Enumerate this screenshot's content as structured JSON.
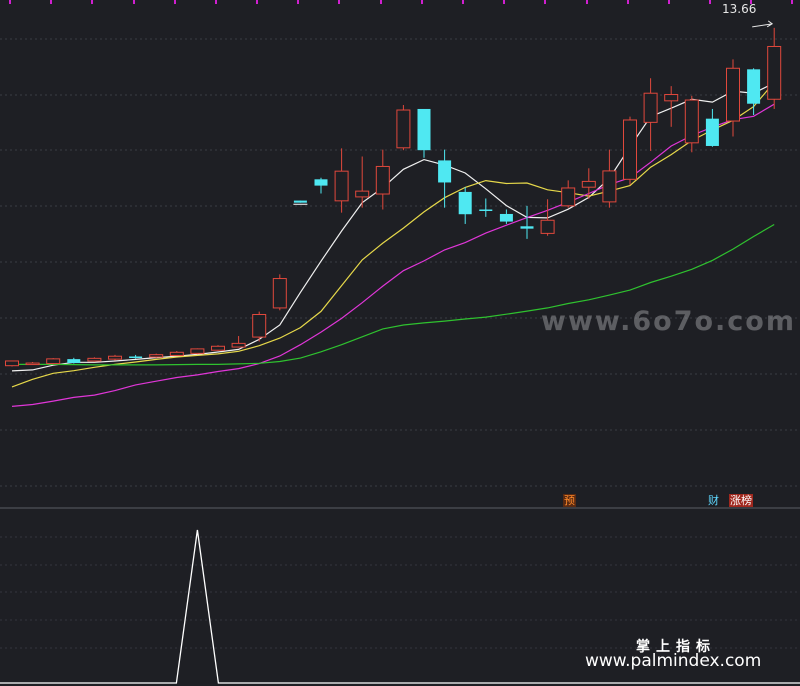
{
  "price_label": "13.66",
  "tags": {
    "yu": "预",
    "cai": "财",
    "zhang": "涨榜"
  },
  "watermark": "www.6o7o.com",
  "footer": {
    "cn": "掌上指标",
    "url": "www.palmindex.com"
  },
  "colors": {
    "background": "#1e1f24",
    "up_candle": "#e0483c",
    "down_candle": "#4fe8f2",
    "ma5": "#f0f0f0",
    "ma10": "#e6d84a",
    "ma20": "#e036d8",
    "ma60": "#2fc22f",
    "signal_line": "#ffffff",
    "top_markers": "#d020d0"
  },
  "chart_data": {
    "type": "candlestick",
    "title": "",
    "ylim": [
      0,
      100
    ],
    "candles": [
      {
        "o": 4.5,
        "c": 6.3,
        "h": 6.4,
        "l": 4.2
      },
      {
        "o": 5.3,
        "c": 5.5,
        "h": 5.9,
        "l": 5.1
      },
      {
        "o": 5.3,
        "c": 7.1,
        "h": 7.4,
        "l": 5.0
      },
      {
        "o": 7.0,
        "c": 5.5,
        "h": 7.5,
        "l": 5.3
      },
      {
        "o": 6.3,
        "c": 7.3,
        "h": 7.7,
        "l": 6.0
      },
      {
        "o": 7.0,
        "c": 8.1,
        "h": 8.6,
        "l": 6.5
      },
      {
        "o": 8.0,
        "c": 7.6,
        "h": 8.6,
        "l": 7.2
      },
      {
        "o": 7.8,
        "c": 8.7,
        "h": 9.1,
        "l": 7.5
      },
      {
        "o": 8.4,
        "c": 9.6,
        "h": 10.1,
        "l": 8.2
      },
      {
        "o": 9.2,
        "c": 10.9,
        "h": 11.1,
        "l": 8.9
      },
      {
        "o": 10.4,
        "c": 11.9,
        "h": 12.3,
        "l": 10.2
      },
      {
        "o": 11.6,
        "c": 13.0,
        "h": 15.8,
        "l": 11.4
      },
      {
        "o": 15.4,
        "c": 24.0,
        "h": 25.1,
        "l": 13.7
      },
      {
        "o": 26.5,
        "c": 37.7,
        "h": 39.3,
        "l": 25.6
      },
      {
        "o": 67.4,
        "c": 66.6,
        "h": 67.4,
        "l": 66.6
      },
      {
        "o": 75.5,
        "c": 73.1,
        "h": 76.1,
        "l": 70.1
      },
      {
        "o": 67.3,
        "c": 78.6,
        "h": 87.3,
        "l": 62.8
      },
      {
        "o": 68.8,
        "c": 71.0,
        "h": 84.2,
        "l": 64.7
      },
      {
        "o": 69.9,
        "c": 80.4,
        "h": 86.8,
        "l": 64.0
      },
      {
        "o": 87.5,
        "c": 101.9,
        "h": 103.8,
        "l": 86.6
      },
      {
        "o": 102.3,
        "c": 86.6,
        "h": 102.3,
        "l": 83.7
      },
      {
        "o": 82.7,
        "c": 74.3,
        "h": 86.8,
        "l": 64.7
      },
      {
        "o": 70.7,
        "c": 62.2,
        "h": 72.5,
        "l": 58.5
      },
      {
        "o": 64.0,
        "c": 63.5,
        "h": 68.2,
        "l": 61.2
      },
      {
        "o": 62.3,
        "c": 59.4,
        "h": 64.0,
        "l": 58.5
      },
      {
        "o": 57.6,
        "c": 56.7,
        "h": 65.4,
        "l": 52.8
      },
      {
        "o": 54.9,
        "c": 59.9,
        "h": 67.9,
        "l": 54.0
      },
      {
        "o": 65.4,
        "c": 72.2,
        "h": 75.1,
        "l": 64.7
      },
      {
        "o": 72.5,
        "c": 74.7,
        "h": 79.7,
        "l": 68.1
      },
      {
        "o": 66.9,
        "c": 78.7,
        "h": 86.8,
        "l": 64.7
      },
      {
        "o": 75.5,
        "c": 98.1,
        "h": 99.4,
        "l": 73.4
      },
      {
        "o": 97.2,
        "c": 108.3,
        "h": 114.0,
        "l": 86.3
      },
      {
        "o": 105.4,
        "c": 107.8,
        "h": 111.0,
        "l": 95.5
      },
      {
        "o": 89.4,
        "c": 105.7,
        "h": 107.3,
        "l": 85.8
      },
      {
        "o": 98.6,
        "c": 88.2,
        "h": 102.3,
        "l": 87.9
      },
      {
        "o": 97.7,
        "c": 117.8,
        "h": 121.2,
        "l": 91.8
      },
      {
        "o": 117.4,
        "c": 104.3,
        "h": 117.8,
        "l": 100.0
      },
      {
        "o": 106.0,
        "c": 126.1,
        "h": 133.2,
        "l": 102.3
      }
    ],
    "ma_series": [
      {
        "name": "MA5",
        "values": [
          2.5,
          2.9,
          4.7,
          5.8,
          5.8,
          6.3,
          6.9,
          7.6,
          8.1,
          8.8,
          9.7,
          10.7,
          14.5,
          20.0,
          32.4,
          44.3,
          55.8,
          66.6,
          72.3,
          79.3,
          83.0,
          80.9,
          77.9,
          71.9,
          65.5,
          61.0,
          60.8,
          64.1,
          68.6,
          75.9,
          87.9,
          99.4,
          102.6,
          106.0,
          104.9,
          109.1,
          108.3,
          112.2
        ]
      },
      {
        "name": "MA10",
        "values": [
          -3.6,
          -0.7,
          1.6,
          2.6,
          3.9,
          5.0,
          5.9,
          6.9,
          7.8,
          8.4,
          9.0,
          10.0,
          12.1,
          15.0,
          19.0,
          25.2,
          35.0,
          44.8,
          51.2,
          56.9,
          63.1,
          68.5,
          72.4,
          75.0,
          73.9,
          74.1,
          71.5,
          70.4,
          69.1,
          71.0,
          73.1,
          80.1,
          84.9,
          90.3,
          94.3,
          98.0,
          103.2,
          112.5
        ]
      },
      {
        "name": "MA20",
        "values": [
          -11.0,
          -10.3,
          -9.0,
          -7.6,
          -6.7,
          -5.0,
          -2.8,
          -1.4,
          0.0,
          1.0,
          2.3,
          3.4,
          5.3,
          8.2,
          12.5,
          17.3,
          22.5,
          28.5,
          34.8,
          40.7,
          44.4,
          48.6,
          51.4,
          55.0,
          58.0,
          60.9,
          63.7,
          66.8,
          70.1,
          73.5,
          76.1,
          82.0,
          88.2,
          92.2,
          95.4,
          98.2,
          99.5,
          104.1
        ]
      },
      {
        "name": "MA60",
        "values": [
          5.0,
          5.0,
          5.0,
          4.9,
          4.8,
          4.8,
          4.8,
          4.8,
          4.9,
          5.0,
          5.0,
          5.2,
          5.4,
          6.1,
          7.4,
          9.8,
          12.5,
          15.5,
          18.5,
          20.0,
          20.8,
          21.5,
          22.3,
          23.0,
          24.1,
          25.3,
          26.5,
          28.2,
          29.6,
          31.4,
          33.3,
          36.2,
          38.6,
          41.2,
          44.6,
          48.9,
          53.7,
          58.3
        ]
      }
    ],
    "hline": {
      "x_index": 14,
      "value": 66.0
    },
    "signal": {
      "values": [
        0,
        0,
        0,
        0,
        0,
        0,
        0,
        0,
        0,
        0,
        0,
        0,
        0,
        0,
        0,
        0,
        0,
        0,
        0,
        0,
        0,
        0,
        0,
        0,
        0,
        0,
        0,
        0,
        0,
        0,
        0,
        0,
        0,
        0,
        0,
        0,
        0,
        0
      ],
      "spike_index": 9,
      "spike_value": 1
    }
  }
}
